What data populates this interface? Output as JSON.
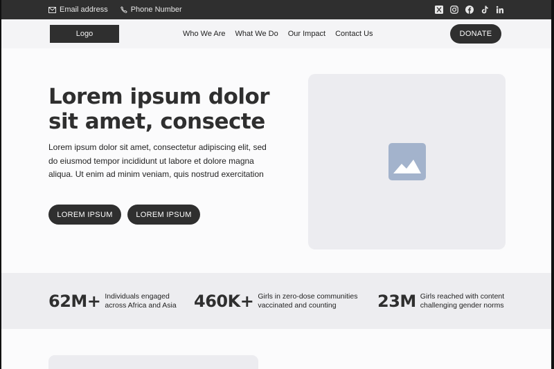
{
  "topbar": {
    "email": "Email address",
    "phone": "Phone Number",
    "socials": [
      "x-icon",
      "instagram-icon",
      "facebook-icon",
      "tiktok-icon",
      "linkedin-icon"
    ]
  },
  "nav": {
    "logo": "Logo",
    "items": [
      "Who We Are",
      "What We Do",
      "Our Impact",
      "Contact Us"
    ],
    "donate": "DONATE"
  },
  "hero": {
    "title_line1": "Lorem ipsum dolor",
    "title_line2": "sit amet, consecte",
    "body": "Lorem ipsum dolor sit amet, consectetur adipiscing elit, sed do eiusmod tempor incididunt ut labore et dolore magna aliqua. Ut enim ad minim veniam, quis nostrud exercitation",
    "button1": "LOREM IPSUM",
    "button2": "LOREM IPSUM",
    "media_icon": "image-placeholder-icon"
  },
  "stats": [
    {
      "value": "62M+",
      "line1": "Individuals engaged",
      "line2": "across Africa and Asia"
    },
    {
      "value": "460K+",
      "line1": "Girls in zero-dose communities",
      "line2": "vaccinated and counting"
    },
    {
      "value": "23M",
      "line1": "Girls reached with content",
      "line2": "challenging gender norms"
    }
  ],
  "colors": {
    "dark": "#2f2f2f",
    "nav_bg": "#f4f4f6",
    "placeholder": "#ececf0",
    "image_icon": "#a3b3cc"
  }
}
